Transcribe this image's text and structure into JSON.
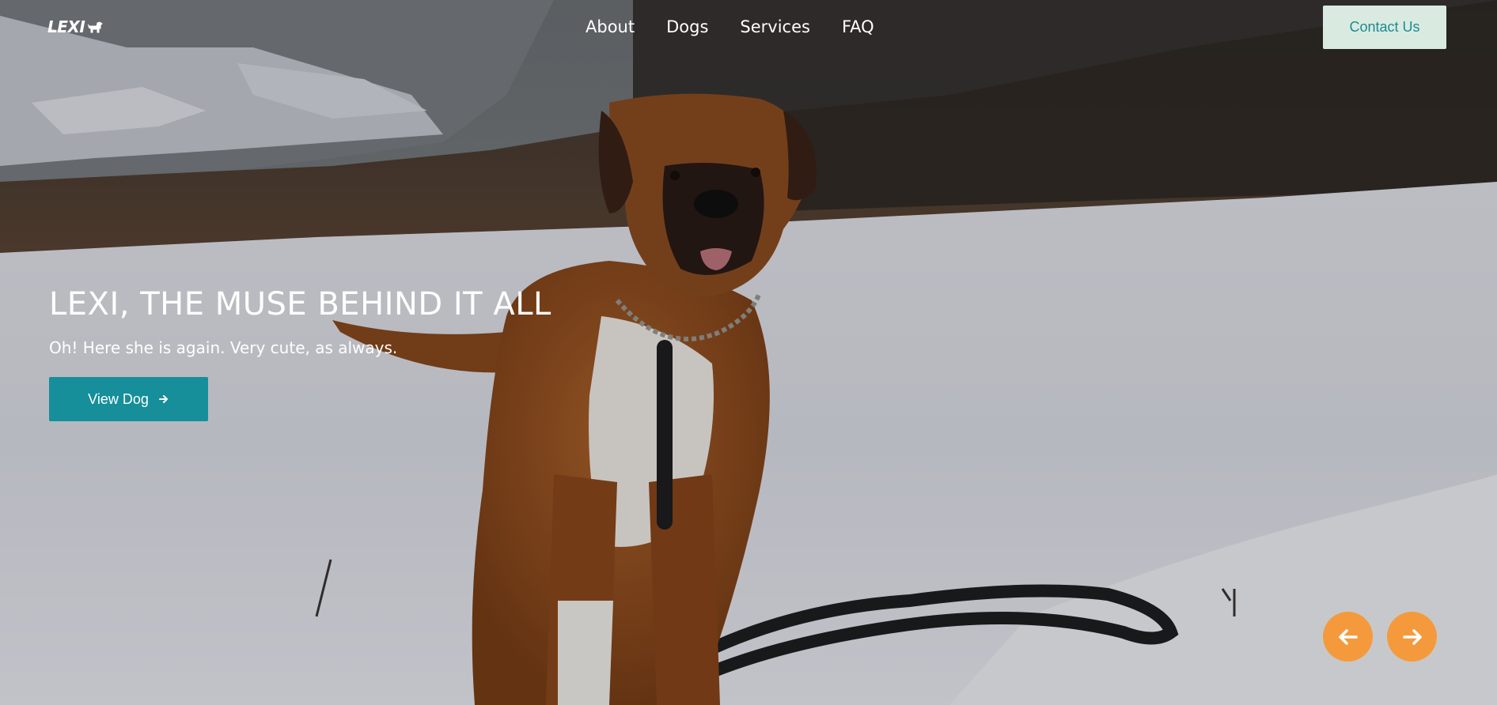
{
  "brand": {
    "logo_text": "LEXI",
    "logo_icon": "dog-icon"
  },
  "nav": {
    "items": [
      {
        "label": "About"
      },
      {
        "label": "Dogs"
      },
      {
        "label": "Services"
      },
      {
        "label": "FAQ"
      }
    ],
    "contact_label": "Contact Us"
  },
  "hero": {
    "title": "LEXI, THE MUSE BEHIND IT ALL",
    "subtitle": "Oh! Here she is again. Very cute, as always.",
    "cta_label": "View Dog",
    "cta_icon": "arrow-right-icon"
  },
  "carousel": {
    "prev_icon": "arrow-left-icon",
    "next_icon": "arrow-right-icon"
  },
  "colors": {
    "accent": "#168f9b",
    "contact_bg": "#d9ebe0",
    "contact_text": "#1b8a93",
    "carousel_btn": "#f59a3c"
  }
}
